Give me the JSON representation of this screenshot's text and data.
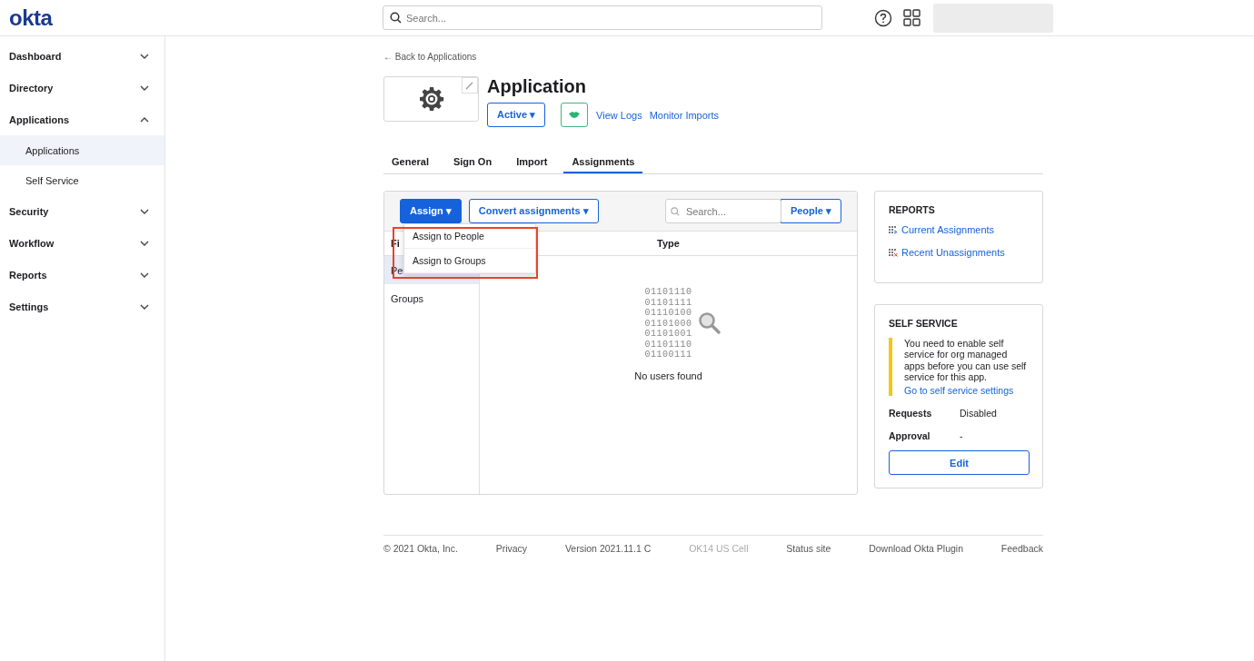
{
  "header": {
    "logo": "okta",
    "search": {
      "placeholder": "Search..."
    }
  },
  "sidebar": {
    "items": [
      {
        "label": "Dashboard",
        "expanded": false
      },
      {
        "label": "Directory",
        "expanded": false
      },
      {
        "label": "Applications",
        "expanded": true,
        "children": [
          {
            "label": "Applications",
            "selected": true
          },
          {
            "label": "Self Service",
            "selected": false
          }
        ]
      },
      {
        "label": "Security",
        "expanded": false
      },
      {
        "label": "Workflow",
        "expanded": false
      },
      {
        "label": "Reports",
        "expanded": false
      },
      {
        "label": "Settings",
        "expanded": false
      }
    ]
  },
  "app": {
    "back_link": "← Back to Applications",
    "title": "Application",
    "status": "Active ▾",
    "links": [
      "View Logs",
      "Monitor Imports"
    ]
  },
  "tabs": [
    {
      "label": "General",
      "selected": false
    },
    {
      "label": "Sign On",
      "selected": false
    },
    {
      "label": "Import",
      "selected": false
    },
    {
      "label": "Assignments",
      "selected": true
    }
  ],
  "assignments": {
    "assign_button": "Assign ▾",
    "convert_button": "Convert assignments ▾",
    "search": {
      "placeholder": "Search..."
    },
    "type_filter": "People ▾",
    "menu": {
      "open": true,
      "items": [
        "Assign to People",
        "Assign to Groups"
      ]
    },
    "filter_heading": "Fi",
    "filters": [
      {
        "label": "Pe",
        "selected": true
      },
      {
        "label": "Groups",
        "selected": false
      }
    ],
    "type_heading": "Type",
    "empty_art": [
      "01101110",
      "01101111",
      "01110100",
      "01101000",
      "01101001",
      "01101110",
      "01100111"
    ],
    "empty_message": "No users found"
  },
  "reports": {
    "title": "REPORTS",
    "links": [
      "Current Assignments",
      "Recent Unassignments"
    ]
  },
  "self_service": {
    "title": "SELF SERVICE",
    "notice": "You need to enable self service for org managed apps before you can use self service for this app.",
    "notice_link": "Go to self service settings",
    "fields": [
      {
        "label": "Requests",
        "value": "Disabled"
      },
      {
        "label": "Approval",
        "value": "-"
      }
    ],
    "edit_button": "Edit"
  },
  "footer": [
    {
      "text": "© 2021 Okta, Inc.",
      "kind": "text"
    },
    {
      "text": "Privacy",
      "kind": "link"
    },
    {
      "text": "Version 2021.11.1 C",
      "kind": "text"
    },
    {
      "text": "OK14 US Cell",
      "kind": "muted"
    },
    {
      "text": "Status site",
      "kind": "link"
    },
    {
      "text": "Download Okta Plugin",
      "kind": "link"
    },
    {
      "text": "Feedback",
      "kind": "link"
    }
  ]
}
